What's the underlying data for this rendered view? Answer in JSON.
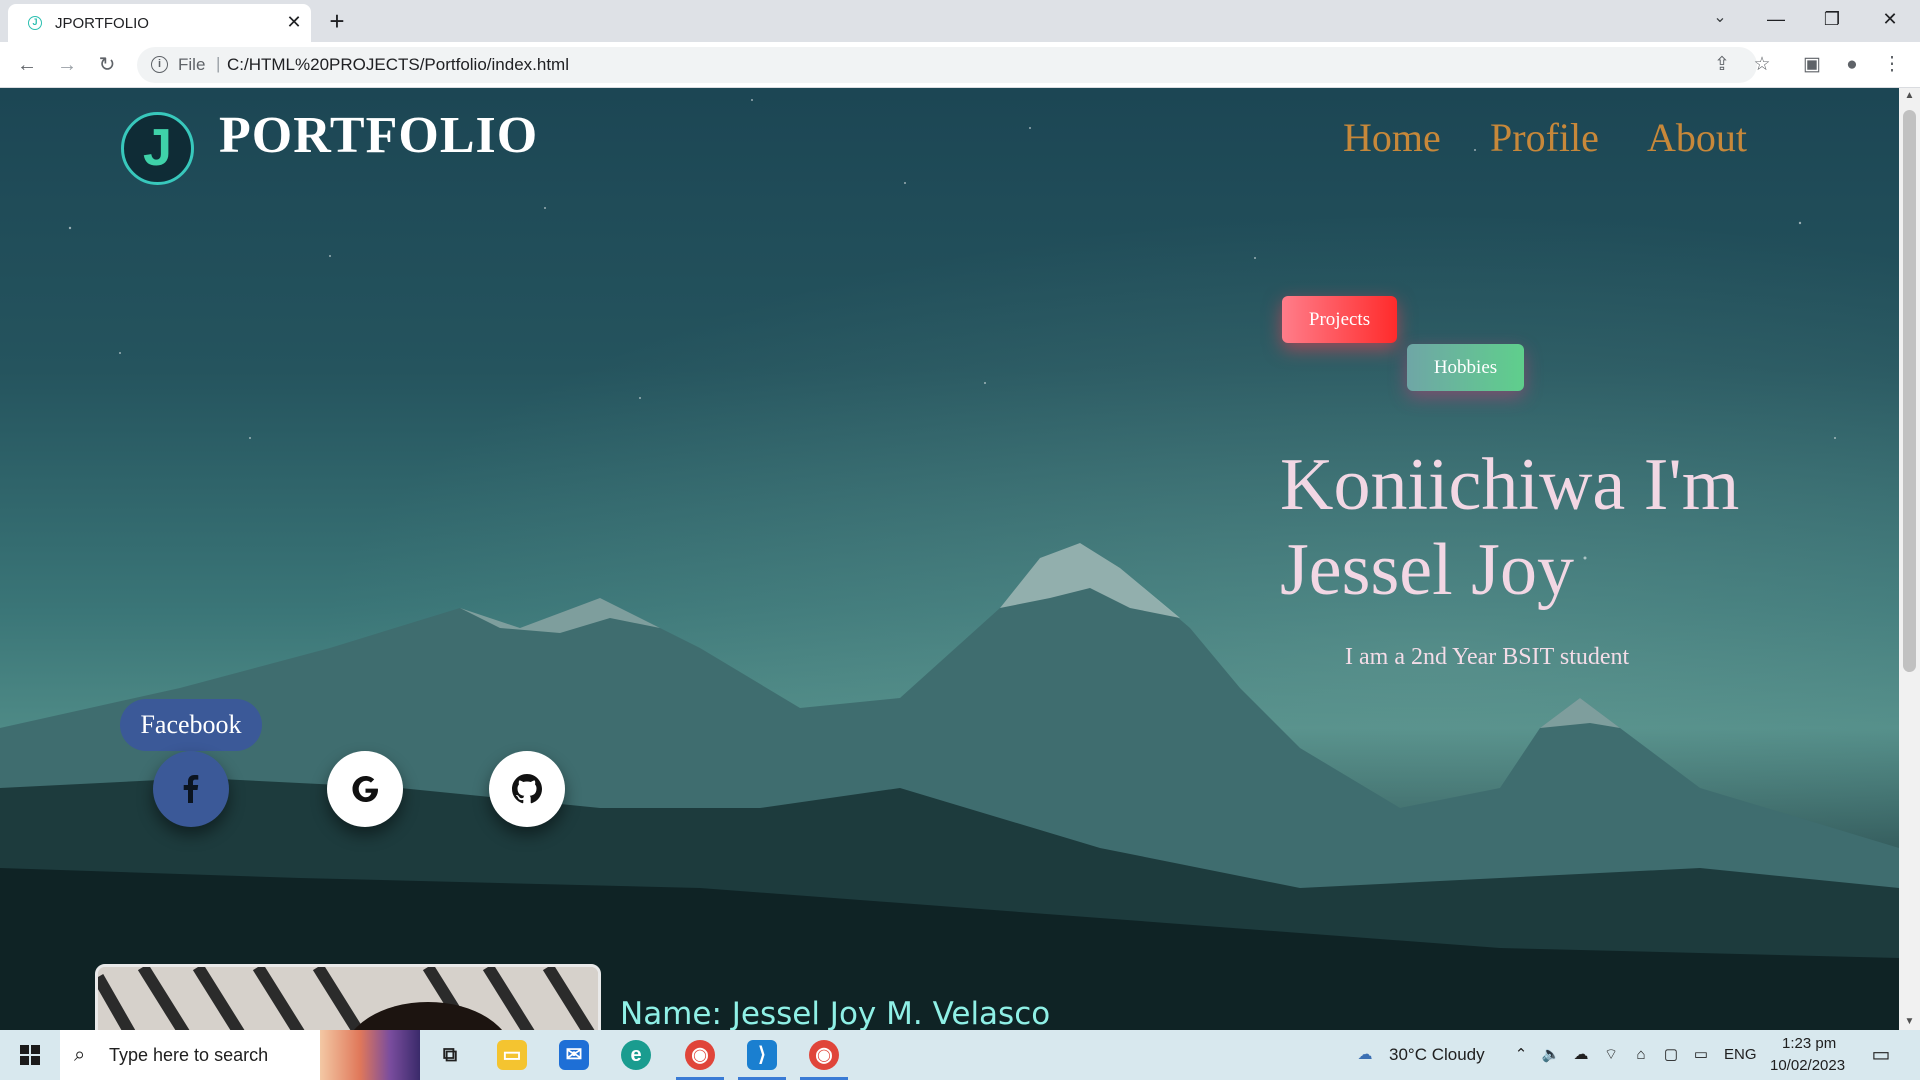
{
  "browser": {
    "tab_title": "JPORTFOLIO",
    "tab_favicon": "J",
    "close_glyph": "✕",
    "new_tab_glyph": "+",
    "address_prefix": "File",
    "url": "C:/HTML%20PROJECTS/Portfolio/index.html",
    "icons": [
      "back-icon",
      "forward-icon",
      "reload-icon",
      "info-icon",
      "share-icon",
      "bookmark-star-icon",
      "side-panel-icon",
      "profile-icon",
      "menu-icon",
      "tab-search-icon",
      "minimize-icon",
      "restore-icon",
      "close-window-icon"
    ]
  },
  "site": {
    "logo_letter": "J",
    "title": "PORTFOLIO",
    "nav": [
      {
        "label": "Home"
      },
      {
        "label": "Profile"
      },
      {
        "label": "About"
      }
    ],
    "buttons": {
      "projects": "Projects",
      "hobbies": "Hobbies"
    },
    "hero": {
      "line1": "Koniichiwa I'm",
      "line2": "Jessel Joy",
      "subtitle": "I am a 2nd Year BSIT student"
    },
    "social": {
      "hover_label": "Facebook",
      "icons": [
        "facebook-icon",
        "google-icon",
        "github-icon"
      ],
      "colors": {
        "facebook": "#3b5998",
        "google": "#ffffff",
        "github": "#ffffff"
      }
    },
    "profile": {
      "name_line": "Name: Jessel Joy M. Velasco"
    },
    "colors": {
      "nav": "#c7883a",
      "hero_text": "#f2d7e4",
      "projects_button": "#ff2b2b",
      "hobbies_button": "#5fcf8c",
      "name_text": "#8ff0e6"
    }
  },
  "taskbar": {
    "search_placeholder": "Type here to search",
    "weather": "30°C  Cloudy",
    "language": "ENG",
    "time": "1:23 pm",
    "date": "10/02/2023",
    "apps": [
      "task-view-icon",
      "file-explorer-icon",
      "mail-icon",
      "edge-icon",
      "chrome-profile-icon",
      "vscode-icon",
      "chrome-icon"
    ]
  }
}
